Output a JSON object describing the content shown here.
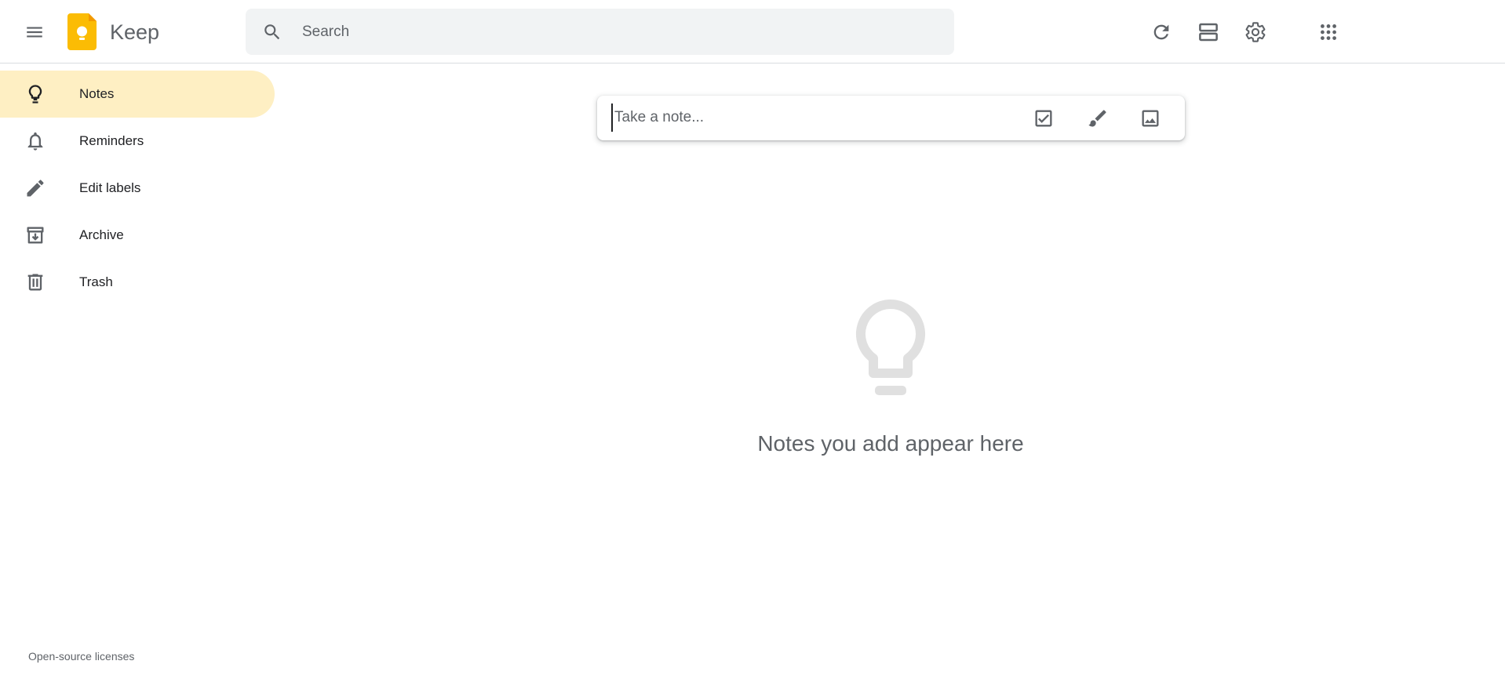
{
  "header": {
    "app_title": "Keep",
    "search_placeholder": "Search",
    "main_menu_icon": "hamburger-menu-icon",
    "refresh_icon": "refresh-icon",
    "list_view_icon": "list-view-icon",
    "settings_icon": "gear-icon",
    "apps_icon": "apps-grid-icon"
  },
  "sidebar": {
    "items": [
      {
        "label": "Notes",
        "icon": "lightbulb-icon",
        "active": true
      },
      {
        "label": "Reminders",
        "icon": "bell-icon",
        "active": false
      },
      {
        "label": "Edit labels",
        "icon": "pencil-icon",
        "active": false
      },
      {
        "label": "Archive",
        "icon": "archive-icon",
        "active": false
      },
      {
        "label": "Trash",
        "icon": "trash-icon",
        "active": false
      }
    ],
    "footer_link": "Open-source licenses"
  },
  "main": {
    "take_note_placeholder": "Take a note...",
    "actions": [
      {
        "icon": "checkbox-icon"
      },
      {
        "icon": "brush-icon"
      },
      {
        "icon": "image-icon"
      }
    ],
    "empty_state_text": "Notes you add appear here"
  },
  "colors": {
    "accent_active": "#feefc3",
    "logo_yellow": "#fbbc04",
    "icon_gray": "#5f6368"
  }
}
